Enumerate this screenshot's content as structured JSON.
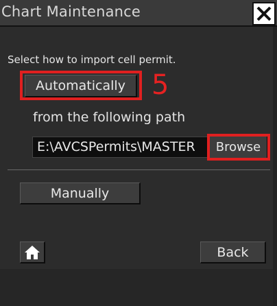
{
  "window": {
    "title": "Chart Maintenance",
    "close_icon": "close-icon"
  },
  "content": {
    "prompt": "Select how to import cell permit.",
    "automatic_button": "Automatically",
    "step_number": "5",
    "from_path_label": "from the following path",
    "path_value": "E:\\AVCSPermits\\MASTER",
    "browse_button": "Browse",
    "manual_button": "Manually"
  },
  "footer": {
    "home_icon": "home-icon",
    "back_button": "Back"
  },
  "colors": {
    "highlight": "#e02020",
    "panel": "#2c2c2c",
    "titlebar": "#3a3a3a"
  }
}
